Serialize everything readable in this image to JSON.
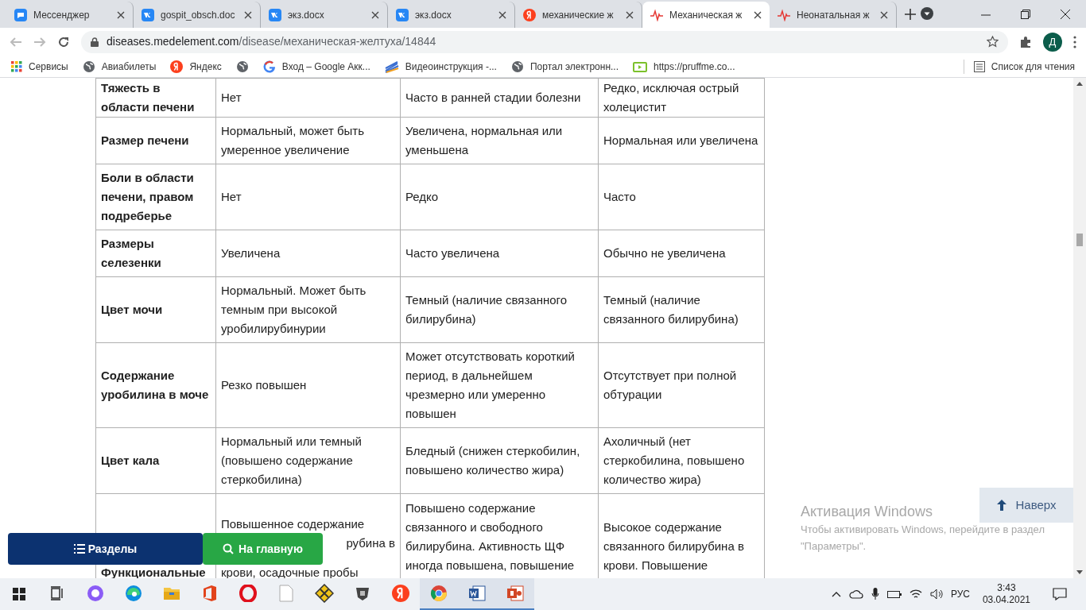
{
  "tabs": [
    {
      "title": "Мессенджер",
      "kind": "messenger",
      "selected": false
    },
    {
      "title": "gospit_obsch.doc",
      "kind": "vk",
      "selected": false
    },
    {
      "title": "экз.docx",
      "kind": "vk",
      "selected": false
    },
    {
      "title": "экз.docx",
      "kind": "vk",
      "selected": false
    },
    {
      "title": "механические ж",
      "kind": "yandex",
      "selected": false
    },
    {
      "title": "Механическая ж",
      "kind": "pulse",
      "selected": true
    },
    {
      "title": "Неонатальная ж",
      "kind": "pulse",
      "selected": false
    }
  ],
  "address": {
    "host": "diseases.medelement.com",
    "path": "/disease/механическая-желтуха/14844"
  },
  "profile": {
    "initial": "Д"
  },
  "bookmarks": [
    {
      "label": "Сервисы",
      "kind": "apps"
    },
    {
      "label": "Авиабилеты",
      "kind": "globe"
    },
    {
      "label": "Яндекс",
      "kind": "yandex"
    },
    {
      "kind": "globe"
    },
    {
      "label": "Вход – Google Акк...",
      "kind": "google"
    },
    {
      "label": "Видеоинструкция -...",
      "kind": "stripes"
    },
    {
      "label": "Портал электронн...",
      "kind": "globe"
    },
    {
      "label": "https://pruffme.co...",
      "kind": "screen"
    }
  ],
  "reading_list": "Список для чтения",
  "table": {
    "rows": [
      {
        "cells": [
          "Тяжесть в области печени",
          "Нет",
          "Часто в ранней стадии болезни",
          "Редко, исключая острый холецистит"
        ]
      },
      {
        "cells": [
          "Размер печени",
          "Нормальный, может быть умеренное увеличение",
          "Увеличена, нормальная или уменьшена",
          "Нормальная или увеличена"
        ]
      },
      {
        "cells": [
          "Боли в области печени, правом подреберье",
          "Нет",
          "Редко",
          "Часто"
        ]
      },
      {
        "cells": [
          "Размеры селезенки",
          "Увеличена",
          "Часто увеличена",
          "Обычно не увеличена"
        ]
      },
      {
        "cells": [
          "Цвет мочи",
          "Нормальный. Может быть темным при высокой уробилирубинурии",
          "Темный (наличие связанного билирубина)",
          "Темный (наличие связанного билирубина)"
        ]
      },
      {
        "cells": [
          "Содержание уробилина в моче",
          "Резко повышен",
          "Может отсутствовать короткий период, в дальнейшем чрезмерно или умеренно повышен",
          "Отсутствует при полной обтурации"
        ]
      },
      {
        "cells": [
          "Цвет кала",
          "Нормальный или темный (повышено содержание стеркобилина)",
          "Бледный (снижен стеркобилин, повышено количество жира)",
          "Ахоличный (нет стеркобилина, повышено количество жира)"
        ]
      }
    ],
    "last_row": [
      [
        {
          "text": "Функциональные",
          "kind": "bottom"
        }
      ],
      [
        {
          "text": "Повышенное содержание",
          "kind": "line"
        },
        {
          "text": "рубина в",
          "kind": "tail"
        },
        {
          "text": "крови, осадочные пробы",
          "kind": "bottom"
        }
      ],
      [
        {
          "text": "Повышено содержание",
          "kind": "line"
        },
        {
          "text": "связанного и свободного",
          "kind": "line"
        },
        {
          "text": "билирубина. Активность ЩФ",
          "kind": "line"
        },
        {
          "text": "иногда повышена, повышение",
          "kind": "line"
        }
      ],
      [
        {
          "text": "Высокое содержание",
          "kind": "line"
        },
        {
          "text": "связанного билирубина в",
          "kind": "line"
        },
        {
          "text": "крови. Повышение",
          "kind": "line"
        }
      ]
    ]
  },
  "buttons": {
    "sections": "Разделы",
    "home": "На главную",
    "top": "Наверх"
  },
  "activation": {
    "title": "Активация Windows",
    "text": "Чтобы активировать Windows, перейдите в раздел \"Параметры\"."
  },
  "taskbar": {
    "apps": [
      {
        "kind": "taskview",
        "running": false
      },
      {
        "kind": "alice",
        "running": false
      },
      {
        "kind": "edge",
        "running": false
      },
      {
        "kind": "folder",
        "running": false
      },
      {
        "kind": "office",
        "running": false
      },
      {
        "kind": "opera",
        "running": false
      },
      {
        "kind": "file",
        "running": false
      },
      {
        "kind": "game",
        "running": false
      },
      {
        "kind": "tank",
        "running": false
      },
      {
        "kind": "yandex",
        "running": false
      },
      {
        "kind": "chrome",
        "running": true
      },
      {
        "kind": "word",
        "running": true
      },
      {
        "kind": "powerpoint",
        "running": true
      }
    ],
    "lang": "РУС",
    "time": "3:43",
    "date": "03.04.2021"
  }
}
